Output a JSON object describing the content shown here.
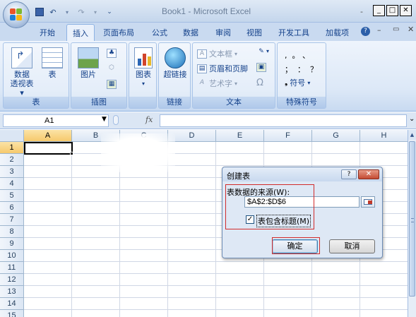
{
  "window": {
    "title": "Book1 - Microsoft Excel",
    "minimize_glyph": "_",
    "plain_minimize": "-"
  },
  "qat": {
    "save_icon": "save-icon",
    "undo_icon": "undo-icon",
    "redo_icon": "redo-icon",
    "customize_icon": "customize-icon"
  },
  "tabs": [
    {
      "label": "开始"
    },
    {
      "label": "插入",
      "active": true
    },
    {
      "label": "页面布局"
    },
    {
      "label": "公式"
    },
    {
      "label": "数据"
    },
    {
      "label": "审阅"
    },
    {
      "label": "视图"
    },
    {
      "label": "开发工具"
    },
    {
      "label": "加载项"
    }
  ],
  "ribbon": {
    "groups": {
      "table": {
        "label": "表",
        "pivot_line1": "数据",
        "pivot_line2": "透视表",
        "table_btn": "表"
      },
      "illustrations": {
        "label": "插图",
        "picture_btn": "图片"
      },
      "charts": {
        "label": "",
        "chart_btn": "图表"
      },
      "links": {
        "label": "链接",
        "hyperlink_btn": "超链接"
      },
      "text": {
        "label": "文本",
        "textbox": "文本框",
        "header_footer": "页眉和页脚",
        "wordart": "艺术字",
        "omega": "Ω"
      },
      "symbols": {
        "label": "特殊符号",
        "symbol_btn": "符号",
        "row1": ",  。 、",
        "row2": "；  ：  ？"
      }
    }
  },
  "formula_bar": {
    "name_box": "A1",
    "fx": "fx",
    "value": ""
  },
  "grid": {
    "columns": [
      "A",
      "B",
      "C",
      "D",
      "E",
      "F",
      "G",
      "H"
    ],
    "rows": [
      "1",
      "2",
      "3",
      "4",
      "5",
      "6",
      "7",
      "8",
      "9",
      "10",
      "11",
      "12",
      "13",
      "14",
      "15"
    ],
    "active_cell": "A1"
  },
  "dialog": {
    "title": "创建表",
    "help_glyph": "?",
    "close_glyph": "✕",
    "source_label": "表数据的来源(W):",
    "range_value": "$A$2:$D$6",
    "checkbox_checked": true,
    "checkbox_glyph": "✓",
    "checkbox_label": "表包含标题(M)",
    "ok": "确定",
    "cancel": "取消"
  },
  "colors": {
    "accent_border": "#d12b2b",
    "tab_text": "#15428b",
    "selection_header": "#f6c96c"
  }
}
